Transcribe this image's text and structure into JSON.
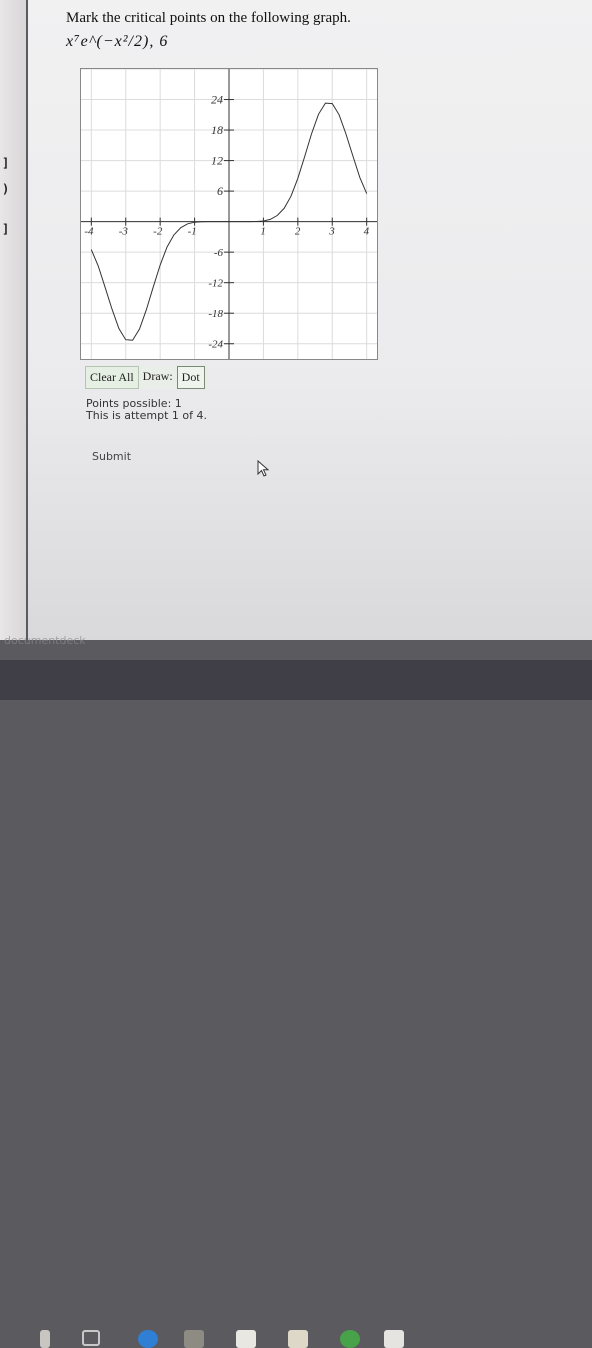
{
  "question": {
    "prompt": "Mark the critical points on the following graph.",
    "formula": "x⁷e^(−x²/2), 6"
  },
  "graph": {
    "x_ticks": [
      "-4",
      "-3",
      "-2",
      "-1",
      "1",
      "2",
      "3",
      "4"
    ],
    "y_ticks_pos": [
      "24",
      "18",
      "12",
      "6"
    ],
    "y_ticks_neg": [
      "-6",
      "-12",
      "-18",
      "-24"
    ]
  },
  "toolbar": {
    "clear_all": "Clear All",
    "draw_label": "Draw:",
    "dot": "Dot"
  },
  "info": {
    "points_possible": "Points possible: 1",
    "attempt": "This is attempt 1 of 4."
  },
  "submit_label": "Submit",
  "watermark": "documentdeck",
  "chart_data": {
    "type": "line",
    "xlim": [
      -4.3,
      4.3
    ],
    "ylim": [
      -27,
      30
    ],
    "x": [
      -4,
      -3.8,
      -3.6,
      -3.4,
      -3.2,
      -3,
      -2.8,
      -2.6,
      -2.4,
      -2.2,
      -2,
      -1.8,
      -1.6,
      -1.4,
      -1.2,
      -1,
      -0.8,
      -0.6,
      -0.4,
      -0.2,
      0,
      0.2,
      0.4,
      0.6,
      0.8,
      1,
      1.2,
      1.4,
      1.6,
      1.8,
      2,
      2.2,
      2.4,
      2.6,
      2.8,
      3,
      3.2,
      3.4,
      3.6,
      3.8,
      4
    ],
    "y": [
      -5.5,
      -8.7,
      -12.9,
      -17.2,
      -21.0,
      -23.2,
      -23.3,
      -21.1,
      -17.3,
      -12.8,
      -8.5,
      -5.0,
      -2.6,
      -1.2,
      -0.43,
      -0.12,
      -0.02,
      0,
      0,
      0,
      0,
      0,
      0,
      0,
      0.02,
      0.12,
      0.43,
      1.2,
      2.6,
      5.0,
      8.5,
      12.8,
      17.3,
      21.1,
      23.3,
      23.2,
      21.0,
      17.2,
      12.9,
      8.7,
      5.5
    ]
  }
}
